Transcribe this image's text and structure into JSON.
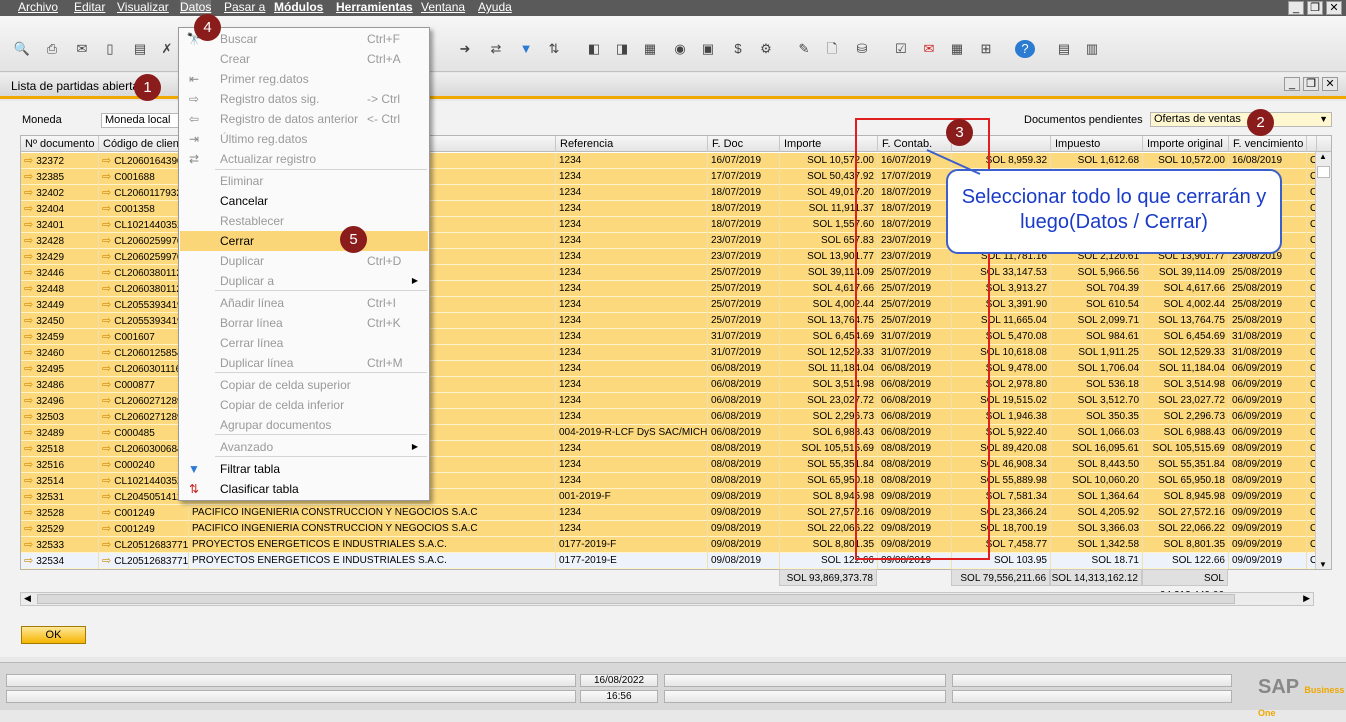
{
  "menubar": {
    "items": [
      "Archivo",
      "Editar",
      "Visualizar",
      "Datos",
      "Pasar a",
      "Módulos",
      "Herramientas",
      "Ventana",
      "Ayuda"
    ]
  },
  "window": {
    "title": "Lista de partidas abiertas"
  },
  "filters": {
    "moneda_label": "Moneda",
    "moneda_value": "Moneda local",
    "docs_label": "Documentos pendientes",
    "docs_value": "Ofertas de ventas"
  },
  "grid": {
    "headers": [
      "Nº documento",
      "Código de cliente",
      "Referencia",
      "F. Doc",
      "Importe",
      "F. Contab.",
      "Impuesto",
      "Importe original",
      "F. vencimiento"
    ],
    "rows": [
      {
        "doc": "32372",
        "cust": "CL2060164390",
        "name": "",
        "ref": "1234",
        "fdoc": "16/07/2019",
        "imp": "SOL 10,572.00",
        "fcont": "16/07/2019",
        "saldo": "SOL 8,959.32",
        "tax": "SOL 1,612.68",
        "orig": "SOL 10,572.00",
        "fvenc": "16/08/2019"
      },
      {
        "doc": "32385",
        "cust": "C001688",
        "name": "",
        "ref": "1234",
        "fdoc": "17/07/2019",
        "imp": "SOL 50,437.92",
        "fcont": "17/07/2019",
        "saldo": "",
        "tax": "",
        "orig": "",
        "fvenc": ""
      },
      {
        "doc": "32402",
        "cust": "CL2060117932",
        "name": "",
        "ref": "1234",
        "fdoc": "18/07/2019",
        "imp": "SOL 49,017.20",
        "fcont": "18/07/2019",
        "saldo": "",
        "tax": "",
        "orig": "",
        "fvenc": ""
      },
      {
        "doc": "32404",
        "cust": "C001358",
        "name": "",
        "ref": "1234",
        "fdoc": "18/07/2019",
        "imp": "SOL 11,911.37",
        "fcont": "18/07/2019",
        "saldo": "",
        "tax": "",
        "orig": "",
        "fvenc": ""
      },
      {
        "doc": "32401",
        "cust": "CL1021440352",
        "name": "",
        "ref": "1234",
        "fdoc": "18/07/2019",
        "imp": "SOL 1,557.60",
        "fcont": "18/07/2019",
        "saldo": "",
        "tax": "",
        "orig": "",
        "fvenc": ""
      },
      {
        "doc": "32428",
        "cust": "CL2060259970",
        "name": "",
        "ref": "1234",
        "fdoc": "23/07/2019",
        "imp": "SOL 657.83",
        "fcont": "23/07/2019",
        "saldo": "",
        "tax": "",
        "orig": "",
        "fvenc": ""
      },
      {
        "doc": "32429",
        "cust": "CL2060259970",
        "name": "",
        "ref": "1234",
        "fdoc": "23/07/2019",
        "imp": "SOL 13,901.77",
        "fcont": "23/07/2019",
        "saldo": "SOL 11,781.16",
        "tax": "SOL 2,120.61",
        "orig": "SOL 13,901.77",
        "fvenc": "23/08/2019"
      },
      {
        "doc": "32446",
        "cust": "CL2060380112",
        "name": "",
        "ref": "1234",
        "fdoc": "25/07/2019",
        "imp": "SOL 39,114.09",
        "fcont": "25/07/2019",
        "saldo": "SOL 33,147.53",
        "tax": "SOL 5,966.56",
        "orig": "SOL 39,114.09",
        "fvenc": "25/08/2019"
      },
      {
        "doc": "32448",
        "cust": "CL2060380112",
        "name": "",
        "ref": "1234",
        "fdoc": "25/07/2019",
        "imp": "SOL 4,617.66",
        "fcont": "25/07/2019",
        "saldo": "SOL 3,913.27",
        "tax": "SOL 704.39",
        "orig": "SOL 4,617.66",
        "fvenc": "25/08/2019"
      },
      {
        "doc": "32449",
        "cust": "CL2055393419",
        "name": "",
        "ref": "1234",
        "fdoc": "25/07/2019",
        "imp": "SOL 4,002.44",
        "fcont": "25/07/2019",
        "saldo": "SOL 3,391.90",
        "tax": "SOL 610.54",
        "orig": "SOL 4,002.44",
        "fvenc": "25/08/2019"
      },
      {
        "doc": "32450",
        "cust": "CL2055393419",
        "name": "",
        "ref": "1234",
        "fdoc": "25/07/2019",
        "imp": "SOL 13,764.75",
        "fcont": "25/07/2019",
        "saldo": "SOL 11,665.04",
        "tax": "SOL 2,099.71",
        "orig": "SOL 13,764.75",
        "fvenc": "25/08/2019"
      },
      {
        "doc": "32459",
        "cust": "C001607",
        "name": "OR E.I.R.L.",
        "ref": "1234",
        "fdoc": "31/07/2019",
        "imp": "SOL 6,454.69",
        "fcont": "31/07/2019",
        "saldo": "SOL 5,470.08",
        "tax": "SOL 984.61",
        "orig": "SOL 6,454.69",
        "fvenc": "31/08/2019"
      },
      {
        "doc": "32460",
        "cust": "CL2060125854",
        "name": "",
        "ref": "1234",
        "fdoc": "31/07/2019",
        "imp": "SOL 12,529.33",
        "fcont": "31/07/2019",
        "saldo": "SOL 10,618.08",
        "tax": "SOL 1,911.25",
        "orig": "SOL 12,529.33",
        "fvenc": "31/08/2019"
      },
      {
        "doc": "32495",
        "cust": "CL2060301116",
        "name": "",
        "ref": "1234",
        "fdoc": "06/08/2019",
        "imp": "SOL 11,184.04",
        "fcont": "06/08/2019",
        "saldo": "SOL 9,478.00",
        "tax": "SOL 1,706.04",
        "orig": "SOL 11,184.04",
        "fvenc": "06/09/2019"
      },
      {
        "doc": "32486",
        "cust": "C000877",
        "name": "",
        "ref": "1234",
        "fdoc": "06/08/2019",
        "imp": "SOL 3,514.98",
        "fcont": "06/08/2019",
        "saldo": "SOL 2,978.80",
        "tax": "SOL 536.18",
        "orig": "SOL 3,514.98",
        "fvenc": "06/09/2019"
      },
      {
        "doc": "32496",
        "cust": "CL2060271289",
        "name": "",
        "ref": "1234",
        "fdoc": "06/08/2019",
        "imp": "SOL 23,027.72",
        "fcont": "06/08/2019",
        "saldo": "SOL 19,515.02",
        "tax": "SOL 3,512.70",
        "orig": "SOL 23,027.72",
        "fvenc": "06/09/2019"
      },
      {
        "doc": "32503",
        "cust": "CL2060271289",
        "name": "",
        "ref": "1234",
        "fdoc": "06/08/2019",
        "imp": "SOL 2,296.73",
        "fcont": "06/08/2019",
        "saldo": "SOL 1,946.38",
        "tax": "SOL 350.35",
        "orig": "SOL 2,296.73",
        "fvenc": "06/09/2019"
      },
      {
        "doc": "32489",
        "cust": "C000485",
        "name": "",
        "ref": "004-2019-R-LCF DyS SAC/MICHI",
        "fdoc": "06/08/2019",
        "imp": "SOL 6,988.43",
        "fcont": "06/08/2019",
        "saldo": "SOL 5,922.40",
        "tax": "SOL 1,066.03",
        "orig": "SOL 6,988.43",
        "fvenc": "06/09/2019"
      },
      {
        "doc": "32518",
        "cust": "CL2060300684",
        "name": "I.R.L.",
        "ref": "1234",
        "fdoc": "08/08/2019",
        "imp": "SOL 105,515.69",
        "fcont": "08/08/2019",
        "saldo": "SOL 89,420.08",
        "tax": "SOL 16,095.61",
        "orig": "SOL 105,515.69",
        "fvenc": "08/09/2019"
      },
      {
        "doc": "32516",
        "cust": "C000240",
        "name": "",
        "ref": "1234",
        "fdoc": "08/08/2019",
        "imp": "SOL 55,351.84",
        "fcont": "08/08/2019",
        "saldo": "SOL 46,908.34",
        "tax": "SOL 8,443.50",
        "orig": "SOL 55,351.84",
        "fvenc": "08/09/2019"
      },
      {
        "doc": "32514",
        "cust": "CL1021440352",
        "name": "",
        "ref": "1234",
        "fdoc": "08/08/2019",
        "imp": "SOL 65,950.18",
        "fcont": "08/08/2019",
        "saldo": "SOL 55,889.98",
        "tax": "SOL 10,060.20",
        "orig": "SOL 65,950.18",
        "fvenc": "08/09/2019"
      },
      {
        "doc": "32531",
        "cust": "CL2045051412",
        "name": "",
        "ref": "001-2019-F",
        "fdoc": "09/08/2019",
        "imp": "SOL 8,945.98",
        "fcont": "09/08/2019",
        "saldo": "SOL 7,581.34",
        "tax": "SOL 1,364.64",
        "orig": "SOL 8,945.98",
        "fvenc": "09/09/2019"
      },
      {
        "doc": "32528",
        "cust": "C001249",
        "name": "PACIFICO INGENIERIA CONSTRUCCION Y NEGOCIOS S.A.C",
        "ref": "1234",
        "fdoc": "09/08/2019",
        "imp": "SOL 27,572.16",
        "fcont": "09/08/2019",
        "saldo": "SOL 23,366.24",
        "tax": "SOL 4,205.92",
        "orig": "SOL 27,572.16",
        "fvenc": "09/09/2019"
      },
      {
        "doc": "32529",
        "cust": "C001249",
        "name": "PACIFICO INGENIERIA CONSTRUCCION Y NEGOCIOS S.A.C",
        "ref": "1234",
        "fdoc": "09/08/2019",
        "imp": "SOL 22,066.22",
        "fcont": "09/08/2019",
        "saldo": "SOL 18,700.19",
        "tax": "SOL 3,366.03",
        "orig": "SOL 22,066.22",
        "fvenc": "09/09/2019"
      },
      {
        "doc": "32533",
        "cust": "CL20512683771",
        "name": "PROYECTOS ENERGETICOS E INDUSTRIALES S.A.C.",
        "ref": "0177-2019-F",
        "fdoc": "09/08/2019",
        "imp": "SOL 8,801.35",
        "fcont": "09/08/2019",
        "saldo": "SOL 7,458.77",
        "tax": "SOL 1,342.58",
        "orig": "SOL 8,801.35",
        "fvenc": "09/09/2019"
      },
      {
        "doc": "32534",
        "cust": "CL20512683771",
        "name": "PROYECTOS ENERGETICOS E INDUSTRIALES S.A.C.",
        "ref": "0177-2019-E",
        "fdoc": "09/08/2019",
        "imp": "SOL 122.66",
        "fcont": "09/08/2019",
        "saldo": "SOL 103.95",
        "tax": "SOL 18.71",
        "orig": "SOL 122.66",
        "fvenc": "09/09/2019"
      }
    ],
    "last_col_val": "O",
    "totals": {
      "imp": "SOL 93,869,373.78",
      "saldo": "SOL 79,556,211.66",
      "tax": "SOL 14,313,162.12",
      "orig": "SOL 94,212,449.06"
    }
  },
  "menu": {
    "items": [
      {
        "label": "Buscar",
        "shortcut": "Ctrl+F",
        "disabled": true,
        "icon": "binoculars"
      },
      {
        "label": "Crear",
        "shortcut": "Ctrl+A",
        "disabled": true,
        "icon": ""
      },
      {
        "label": "Primer reg.datos",
        "shortcut": "",
        "disabled": true,
        "icon": "first"
      },
      {
        "label": "Registro datos sig.",
        "shortcut": "-> Ctrl",
        "disabled": true,
        "icon": "next"
      },
      {
        "label": "Registro de datos anterior",
        "shortcut": "<- Ctrl",
        "disabled": true,
        "icon": "prev"
      },
      {
        "label": "Último reg.datos",
        "shortcut": "",
        "disabled": true,
        "icon": "last"
      },
      {
        "label": "Actualizar registro",
        "shortcut": "",
        "disabled": true,
        "icon": "refresh"
      },
      {
        "label": "Eliminar",
        "shortcut": "",
        "disabled": true,
        "icon": ""
      },
      {
        "label": "Cancelar",
        "shortcut": "",
        "disabled": false,
        "icon": ""
      },
      {
        "label": "Restablecer",
        "shortcut": "",
        "disabled": true,
        "icon": ""
      },
      {
        "label": "Cerrar",
        "shortcut": "",
        "disabled": false,
        "icon": "",
        "highlight": true
      },
      {
        "label": "Duplicar",
        "shortcut": "Ctrl+D",
        "disabled": true,
        "icon": ""
      },
      {
        "label": "Duplicar a",
        "shortcut": "",
        "disabled": true,
        "icon": "",
        "submenu": true
      },
      {
        "label": "Añadir línea",
        "shortcut": "Ctrl+I",
        "disabled": true,
        "icon": ""
      },
      {
        "label": "Borrar línea",
        "shortcut": "Ctrl+K",
        "disabled": true,
        "icon": ""
      },
      {
        "label": "Cerrar línea",
        "shortcut": "",
        "disabled": true,
        "icon": ""
      },
      {
        "label": "Duplicar línea",
        "shortcut": "Ctrl+M",
        "disabled": true,
        "icon": ""
      },
      {
        "label": "Copiar de celda superior",
        "shortcut": "",
        "disabled": true,
        "icon": ""
      },
      {
        "label": "Copiar de celda inferior",
        "shortcut": "",
        "disabled": true,
        "icon": ""
      },
      {
        "label": "Agrupar documentos",
        "shortcut": "",
        "disabled": true,
        "icon": ""
      },
      {
        "label": "Avanzado",
        "shortcut": "",
        "disabled": true,
        "icon": "",
        "submenu": true
      },
      {
        "label": "Filtrar tabla",
        "shortcut": "",
        "disabled": false,
        "icon": "filter"
      },
      {
        "label": "Clasificar tabla",
        "shortcut": "",
        "disabled": false,
        "icon": "sort"
      }
    ]
  },
  "annotations": {
    "badges": [
      "1",
      "2",
      "3",
      "4",
      "5"
    ],
    "callout": "Seleccionar todo lo que cerrarán y luego(Datos / Cerrar)"
  },
  "buttons": {
    "ok": "OK"
  },
  "status": {
    "date": "16/08/2022",
    "time": "16:56"
  },
  "brand": {
    "logo": "SAP",
    "sub": "Business One",
    "accent": "#f0a800"
  }
}
